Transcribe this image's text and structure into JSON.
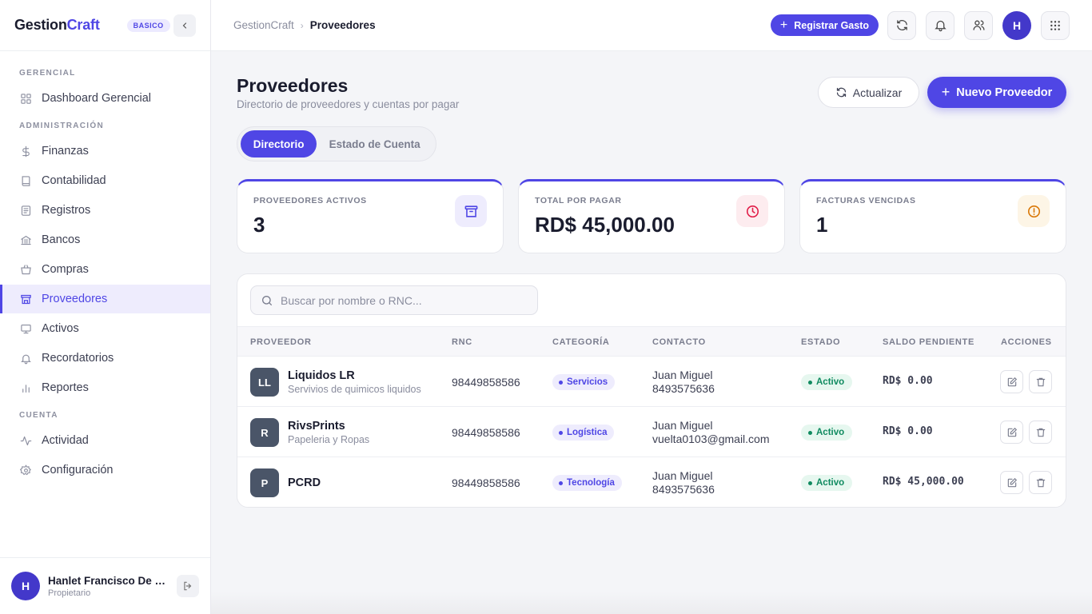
{
  "brand": {
    "name_part1": "Gestion",
    "name_part2": "Craft",
    "plan": "BASICO"
  },
  "sidebar": {
    "sections": [
      {
        "title": "GERENCIAL"
      },
      {
        "title": "ADMINISTRACIÓN"
      },
      {
        "title": "CUENTA"
      }
    ],
    "items": [
      {
        "label": "Dashboard Gerencial",
        "icon": "grid-icon"
      },
      {
        "label": "Finanzas",
        "icon": "dollar-icon"
      },
      {
        "label": "Contabilidad",
        "icon": "book-icon"
      },
      {
        "label": "Registros",
        "icon": "list-icon"
      },
      {
        "label": "Bancos",
        "icon": "bank-icon"
      },
      {
        "label": "Compras",
        "icon": "basket-icon"
      },
      {
        "label": "Proveedores",
        "icon": "store-icon",
        "active": true
      },
      {
        "label": "Activos",
        "icon": "monitor-icon"
      },
      {
        "label": "Recordatorios",
        "icon": "bell-icon"
      },
      {
        "label": "Reportes",
        "icon": "chart-icon"
      },
      {
        "label": "Actividad",
        "icon": "activity-icon"
      },
      {
        "label": "Configuración",
        "icon": "gear-icon"
      }
    ]
  },
  "user": {
    "initial": "H",
    "name": "Hanlet Francisco De L...",
    "role": "Propietario"
  },
  "topbar": {
    "breadcrumb_root": "GestionCraft",
    "breadcrumb_current": "Proveedores",
    "register_expense": "Registrar Gasto",
    "avatar_initial": "H"
  },
  "page": {
    "title": "Proveedores",
    "subtitle": "Directorio de proveedores y cuentas por pagar",
    "refresh_label": "Actualizar",
    "new_label": "Nuevo Proveedor",
    "tabs": [
      "Directorio",
      "Estado de Cuenta"
    ]
  },
  "stats": [
    {
      "label": "PROVEEDORES ACTIVOS",
      "value": "3",
      "icon": "archive-icon",
      "color": "#4f46e5",
      "bg": "#eeecfd"
    },
    {
      "label": "TOTAL POR PAGAR",
      "value": "RD$ 45,000.00",
      "icon": "clock-icon",
      "color": "#e11d48",
      "bg": "#fdecef"
    },
    {
      "label": "FACTURAS VENCIDAS",
      "value": "1",
      "icon": "alert-icon",
      "color": "#d97706",
      "bg": "#fdf5e6"
    }
  ],
  "table": {
    "search_placeholder": "Buscar por nombre o RNC...",
    "columns": [
      "PROVEEDOR",
      "RNC",
      "CATEGORÍA",
      "CONTACTO",
      "ESTADO",
      "SALDO PENDIENTE",
      "ACCIONES"
    ],
    "rows": [
      {
        "initials": "LL",
        "name": "Liquidos LR",
        "desc": "Servivios de quimicos liquidos",
        "rnc": "98449858586",
        "category": "Servicios",
        "contact_name": "Juan Miguel",
        "contact_info": "8493575636",
        "status": "Activo",
        "balance": "RD$ 0.00"
      },
      {
        "initials": "R",
        "name": "RivsPrints",
        "desc": "Papeleria y Ropas",
        "rnc": "98449858586",
        "category": "Logística",
        "contact_name": "Juan Miguel",
        "contact_info": "vuelta0103@gmail.com",
        "status": "Activo",
        "balance": "RD$ 0.00"
      },
      {
        "initials": "P",
        "name": "PCRD",
        "desc": "",
        "rnc": "98449858586",
        "category": "Tecnología",
        "contact_name": "Juan Miguel",
        "contact_info": "8493575636",
        "status": "Activo",
        "balance": "RD$ 45,000.00"
      }
    ]
  }
}
